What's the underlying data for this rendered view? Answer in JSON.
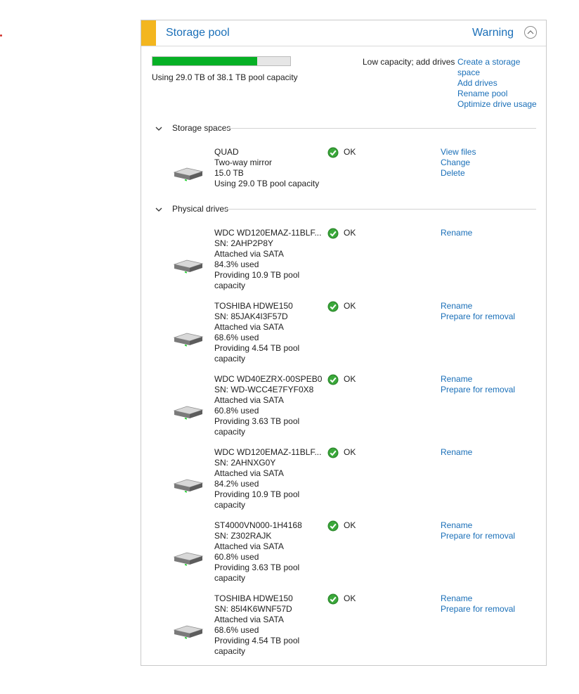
{
  "pool": {
    "title": "Storage pool",
    "status": "Warning",
    "usage_fraction": 0.761,
    "usage_text": "Using 29.0 TB of 38.1 TB pool capacity",
    "warning_text": "Low capacity; add drives",
    "actions": [
      "Create a storage space",
      "Add drives",
      "Rename pool",
      "Optimize drive usage"
    ],
    "accent_color": "#f3b61f",
    "bar_color": "#06b025"
  },
  "sections": {
    "spaces": "Storage spaces",
    "physical": "Physical drives"
  },
  "space": {
    "lines": [
      "QUAD",
      "Two-way mirror",
      "15.0 TB",
      "Using 29.0 TB pool capacity"
    ],
    "status": "OK",
    "links": [
      "View files",
      "Change",
      "Delete"
    ]
  },
  "drives": [
    {
      "lines": [
        "WDC WD120EMAZ-11BLF...",
        "SN: 2AHP2P8Y",
        "Attached via SATA",
        "84.3% used",
        "Providing 10.9 TB pool",
        "capacity"
      ],
      "status": "OK",
      "links": [
        "Rename"
      ]
    },
    {
      "lines": [
        "TOSHIBA HDWE150",
        "SN: 85JAK4I3F57D",
        "Attached via SATA",
        "68.6% used",
        "Providing 4.54 TB pool",
        "capacity"
      ],
      "status": "OK",
      "links": [
        "Rename",
        "Prepare for removal"
      ]
    },
    {
      "lines": [
        "WDC WD40EZRX-00SPEB0",
        "SN: WD-WCC4E7FYF0X8",
        "Attached via SATA",
        "60.8% used",
        "Providing 3.63 TB pool",
        "capacity"
      ],
      "status": "OK",
      "links": [
        "Rename",
        "Prepare for removal"
      ]
    },
    {
      "lines": [
        "WDC WD120EMAZ-11BLF...",
        "SN: 2AHNXG0Y",
        "Attached via SATA",
        "84.2% used",
        "Providing 10.9 TB pool",
        "capacity"
      ],
      "status": "OK",
      "links": [
        "Rename"
      ]
    },
    {
      "lines": [
        "ST4000VN000-1H4168",
        "SN: Z302RAJK",
        "Attached via SATA",
        "60.8% used",
        "Providing 3.63 TB pool",
        "capacity"
      ],
      "status": "OK",
      "links": [
        "Rename",
        "Prepare for removal"
      ]
    },
    {
      "lines": [
        "TOSHIBA HDWE150",
        "SN: 85I4K6WNF57D",
        "Attached via SATA",
        "68.6% used",
        "Providing 4.54 TB pool",
        "capacity"
      ],
      "status": "OK",
      "links": [
        "Rename",
        "Prepare for removal"
      ]
    }
  ]
}
